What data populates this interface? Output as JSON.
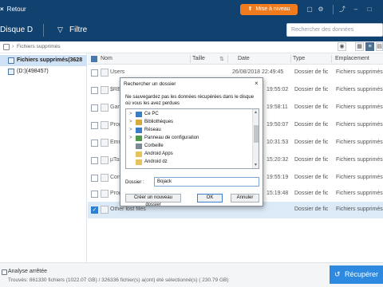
{
  "titlebar": {
    "back_icon": "close-icon",
    "back_label": "Retour",
    "update_label": "Mise à niveau",
    "icons": [
      "cart-icon",
      "gear-icon",
      "share-icon",
      "minimize-icon",
      "maximize-icon"
    ]
  },
  "toolbar": {
    "disk_label": "Disque D",
    "filter_label": "Filtre",
    "search_placeholder": "Rechercher des données"
  },
  "breadcrumb": {
    "path": "Fichiers supprimés"
  },
  "tree": [
    {
      "label": "Fichiers supprimés(3628",
      "selected": true
    },
    {
      "label": "(D:)(498457)",
      "selected": false
    }
  ],
  "table": {
    "columns": [
      "Nom",
      "Taille",
      "Date",
      "Type",
      "Emplacement"
    ],
    "rows": [
      {
        "name": "Users",
        "size": "",
        "date": "26/08/2018 22:49:45",
        "type": "Dossier de fic",
        "location": "Fichiers supprimés",
        "checked": false,
        "selected": false
      },
      {
        "name": "$REC",
        "size": "",
        "date": "19:55:02",
        "type": "Dossier de fic",
        "location": "Fichiers supprimés",
        "checked": false,
        "selected": false
      },
      {
        "name": "Gam",
        "size": "",
        "date": "19:58:11",
        "type": "Dossier de fic",
        "location": "Fichiers supprimés",
        "checked": false,
        "selected": false
      },
      {
        "name": "Prog",
        "size": "",
        "date": "19:50:07",
        "type": "Dossier de fic",
        "location": "Fichiers supprimés",
        "checked": false,
        "selected": false
      },
      {
        "name": "Emul",
        "size": "",
        "date": "10:31:53",
        "type": "Dossier de fic",
        "location": "Fichiers supprimés",
        "checked": false,
        "selected": false
      },
      {
        "name": "µTor",
        "size": "",
        "date": "15:20:32",
        "type": "Dossier de fic",
        "location": "Fichiers supprimés",
        "checked": false,
        "selected": false
      },
      {
        "name": "Conf",
        "size": "",
        "date": "19:55:19",
        "type": "Dossier de fic",
        "location": "Fichiers supprimés",
        "checked": false,
        "selected": false
      },
      {
        "name": "Prog",
        "size": "",
        "date": "15:19:48",
        "type": "Dossier de fic",
        "location": "Fichiers supprimés",
        "checked": false,
        "selected": false
      },
      {
        "name": "Other lost files",
        "size": "",
        "date": "",
        "type": "Dossier de fic",
        "location": "Fichiers supprimés",
        "checked": true,
        "selected": true
      }
    ]
  },
  "dialog": {
    "title": "Rechercher un dossier",
    "close": "×",
    "message": "Ne sauvegardez pas les données récupérées dans le disque où vous les avez perdues",
    "folders": [
      {
        "label": "Ce PC",
        "toggle": ">",
        "icon_color": "#3b7dc4"
      },
      {
        "label": "Bibliothèques",
        "toggle": ">",
        "icon_color": "#d9a93a"
      },
      {
        "label": "Réseau",
        "toggle": ">",
        "icon_color": "#3b7dc4"
      },
      {
        "label": "Panneau de configuration",
        "toggle": ">",
        "icon_color": "#4a9a4a"
      },
      {
        "label": "Corbeille",
        "toggle": "",
        "icon_color": "#7d8a96"
      },
      {
        "label": "Android Apps",
        "toggle": "",
        "icon_color": "#e8c25a"
      },
      {
        "label": "Android dz",
        "toggle": "",
        "icon_color": "#e8c25a"
      }
    ],
    "folder_label": "Dossier :",
    "folder_value": "Bojack",
    "new_folder_label": "Créer un nouveau dossier",
    "ok_label": "OK",
    "cancel_label": "Annuler"
  },
  "status": {
    "title": "Analyse arrêtée",
    "details": "Trouvés: 861330 fichiers (1022.07 GB) / 326336 fichier(s) a(ont) été sélectionné(s) ( 230.79 GB)"
  },
  "recover_label": "Récupérer"
}
